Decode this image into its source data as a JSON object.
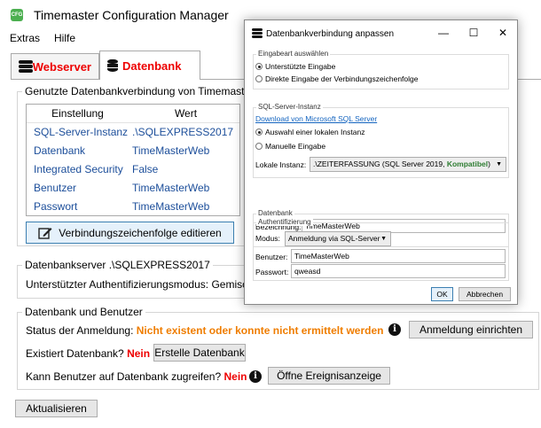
{
  "main": {
    "app_icon_text": "CFG",
    "title": "Timemaster Configuration Manager",
    "menu": [
      "Extras",
      "Hilfe"
    ],
    "tabs": [
      {
        "label": "Webserver",
        "icon": "database-icon"
      },
      {
        "label": "Datenbank",
        "icon": "database-cylinder-icon"
      }
    ],
    "connection_group": {
      "title": "Genutzte Datenbankverbindung von Timemaster",
      "columns": [
        "Einstellung",
        "Wert"
      ],
      "rows": [
        [
          "SQL-Server-Instanz",
          ".\\SQLEXPRESS2017"
        ],
        [
          "Datenbank",
          "TimeMasterWeb"
        ],
        [
          "Integrated Security",
          "False"
        ],
        [
          "Benutzer",
          "TimeMasterWeb"
        ],
        [
          "Passwort",
          "TimeMasterWeb"
        ]
      ],
      "edit_button": "Verbindungszeichenfolge editieren",
      "edit_icon": "edit-icon"
    },
    "server_group": {
      "title": "Datenbankserver .\\SQLEXPRESS2017",
      "auth_mode": "Unterstützter Authentifizierungsmodus: Gemisch"
    },
    "db_user_group": {
      "title": "Datenbank und Benutzer",
      "status_label": "Status der Anmeldung:",
      "status_value": "Nicht existent oder konnte nicht ermittelt werden",
      "setup_login_button": "Anmeldung einrichten",
      "db_exists_label": "Existiert Datenbank?",
      "db_exists_value": "Nein",
      "create_db_button": "Erstelle Datenbank",
      "access_label": "Kann Benutzer auf Datenbank zugreifen?",
      "access_value": "Nein",
      "event_viewer_button": "Öffne Ereignisanzeige",
      "info_glyph": "i"
    },
    "refresh_button": "Aktualisieren"
  },
  "dialog": {
    "title": "Datenbankverbindung anpassen",
    "controls": {
      "minimize": "—",
      "maximize": "☐",
      "close": "✕"
    },
    "input_mode": {
      "title": "Eingabeart auswählen",
      "options": [
        "Unterstützte Eingabe",
        "Direkte Eingabe der Verbindungszeichenfolge"
      ],
      "selected": "Unterstützte Eingabe"
    },
    "instance": {
      "title": "SQL-Server-Instanz",
      "download_link": "Download von Microsoft SQL Server",
      "options": [
        "Auswahl einer lokalen Instanz",
        "Manuelle Eingabe"
      ],
      "selected": "Auswahl einer lokalen Instanz",
      "local_label": "Lokale Instanz:",
      "local_value": ".\\ZEITERFASSUNG (SQL Server 2019, ",
      "local_value_compat": "Kompatibel",
      "local_value_end": ")"
    },
    "database": {
      "title": "Datenbank",
      "name_label": "Bezeichnung:",
      "name_value": "TimeMasterWeb"
    },
    "auth": {
      "title": "Authentifizierung",
      "mode_label": "Modus:",
      "mode_value": "Anmeldung via SQL-Server",
      "user_label": "Benutzer:",
      "user_value": "TimeMasterWeb",
      "password_label": "Passwort:",
      "password_value": "qweasd"
    },
    "ok_button": "OK",
    "cancel_button": "Abbrechen"
  },
  "colors": {
    "tab_label": "#e00000",
    "link_blue": "#1c4e9a",
    "warning_orange": "#ef7d00",
    "no_red": "#e00000",
    "compatible_green": "#2e7d32"
  }
}
